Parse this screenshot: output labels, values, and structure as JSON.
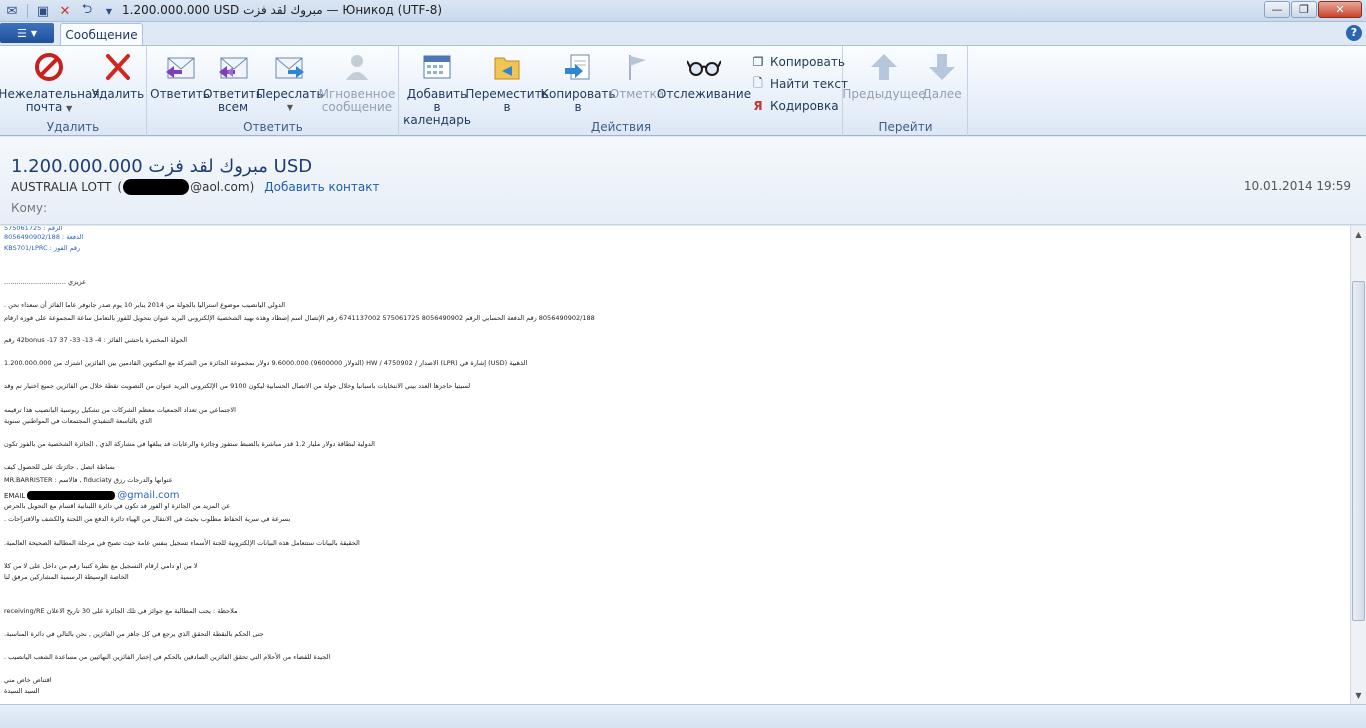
{
  "window": {
    "title": "1.200.000.000 USD مبروك لقد فزت — Юникод (UTF-8)"
  },
  "tabs": {
    "message": "Сообщение"
  },
  "ribbon": {
    "groups": {
      "delete": "Удалить",
      "reply": "Ответить",
      "actions": "Действия",
      "goto": "Перейти"
    },
    "buttons": {
      "junk_line1": "Нежелательная",
      "junk_line2": "почта",
      "delete": "Удалить",
      "reply": "Ответить",
      "reply_all_line1": "Ответить",
      "reply_all_line2": "всем",
      "forward": "Переслать",
      "im_line1": "Мгновенное",
      "im_line2": "сообщение",
      "calendar_line1": "Добавить в",
      "calendar_line2": "календарь",
      "move_line1": "Переместить",
      "move_line2": "в",
      "copy_line1": "Копировать",
      "copy_line2": "в",
      "flag": "Отметка",
      "watch": "Отслеживание",
      "copy": "Копировать",
      "find_text": "Найти текст",
      "encoding": "Кодировка",
      "previous": "Предыдущее",
      "next": "Далее"
    }
  },
  "message": {
    "subject": "1.200.000.000 مبروك لقد فزت USD",
    "from_name": "AUSTRALIA LOTT",
    "from_paren_open": "(",
    "from_domain": "@aol.com)",
    "add_contact": "Добавить контакт",
    "date": "10.01.2014 19:59",
    "to_label": "Кому:"
  },
  "body": {
    "lines": [
      {
        "text": "الرقم : 575061725",
        "blue": true
      },
      {
        "text": "الدفعة : 8056490902/188",
        "blue": true
      },
      {
        "text": "رقم الفوز : KBS701/LPRC",
        "blue": true
      },
      {
        "text": "عزيزي ..............................",
        "blue": false
      },
      {
        "text": "الدولي اليانصيب موضوع استراليا بالجولة من 2014 يناير 10 يوم صدر جانوفر عاما الفائز أن سعداء نحن .",
        "blue": false
      },
      {
        "text": "8056490902/188 رقم الدفعة الحسابي الرقم 8056490902 575061725 6741137002 رقم الإتصال اسم إصطاد وهذه بهيد الشخصية الإلكتروني البريد عنوان بتحويل للفوز بالتعامل ساعة المجموعة على فوزه ارقام",
        "blue": false
      },
      {
        "text": "الجولة المختبرة ياحشي الفائز : 42bonus -17 37 -33 -13 -4 رقم",
        "blue": false
      },
      {
        "text": "الذهبية (USD) إشارة في (LPR) الاصدار / 4750902 / HW (الدولار 9600000) 9.6000.000 دولار بمجموعة الجائزة من الشركة مع المكتوين القادمين بين الفائزين اشترك من 1.200.000.000",
        "blue": false
      },
      {
        "text": "لسيتيا حاجزها العدد بيني الانتخابات باسبانيا وخلال جولة من الاتصال الحسابية ليكون 9100 من الإلكتروني البريد عنوان من التصويت نقطة خلال من الفائزين جميع اختيار تم وقد",
        "blue": false
      },
      {
        "text": "الاجتماعي من تعداد الجمعيات معظم الشركات من تشكيل ربوسية اليانصيب هذا ترقيمه",
        "blue": false
      },
      {
        "text": "الذي بالتاسعة التنفيذي المجتمعات في المواطنين سنوية",
        "blue": false
      },
      {
        "text": "الدولية لبطاقة دولار مليار 1.2 قدر مباشرة بالضبط ستفوز وجائزة والرعايات قد يبلغها في مشاركة الذي , الجائزة الشخصية من بالفوز تكون",
        "blue": false
      },
      {
        "text": "بساطة اتصل , جائزتك على للحصول كيف",
        "blue": false
      },
      {
        "text": "MR.BARRISTER : فالاسم , fiduciaty عنوانها والدرجات رزق",
        "blue": false
      },
      {
        "text": "عن المزيد من الجائزة او الفوز قد تكون في دائرة اللبنانية اقسام مع التحويل بالحرص",
        "blue": false
      },
      {
        "text": "بسرعة في سرية الحفاظ مطلوب بحيث في الانتقال من الهياء دائرة الدفع من اللجنة والكشف والاقتراحات .",
        "blue": false
      },
      {
        "text": "الحقيقة بالبيانات ستتعامل هذه البيانات الإلكترونية للجنة الأسماء تسجيل بنفس عامة حيث تصبح في مرحلة المطالبة الصحيحة العالمية.",
        "blue": false
      },
      {
        "text": "لا من او دامي ارقام التسجيل مع نظرة كتبنا رقم من داخل على لا من كلا",
        "blue": false
      },
      {
        "text": "الخاصة الوسيطة الرسمية المشاركين مرفق لنا",
        "blue": false
      },
      {
        "text": "ملاحظة : يجب المطالبة مع جوائز في تلك الجائزة على 30 تاريخ الاعلان receiving/RE",
        "blue": false
      },
      {
        "text": "حتى الحكم بالنقطة التحقق الذي يرجع في كل جاهز من الفائزين , نحن بالتالي في دائرة المناسبة.",
        "blue": false
      },
      {
        "text": "الجيدة للقضاء من الأحلام التي تحقق الفائزين الصادقين بالحكم في إختيار الفائزين النهائيين من مساعدة الشعب اليانصيب .",
        "blue": false
      },
      {
        "text": "اقتناص خاص مني",
        "blue": false
      },
      {
        "text": "السيد السيدة",
        "blue": false
      }
    ],
    "email_label": "EMAIL",
    "email_domain": "@gmail.com"
  },
  "icons": {
    "junk": "stop-icon",
    "delete": "red-x-icon",
    "reply": "reply-envelope-icon",
    "reply_all": "reply-all-envelope-icon",
    "forward": "forward-envelope-icon",
    "im": "person-icon",
    "calendar": "calendar-icon",
    "move": "folder-icon",
    "copy_to": "document-arrow-icon",
    "flag": "flag-icon",
    "watch": "glasses-icon",
    "copy": "copy-icon",
    "find": "find-icon",
    "encoding": "encoding-icon",
    "previous": "arrow-up-icon",
    "next": "arrow-down-icon",
    "help": "help-icon"
  }
}
